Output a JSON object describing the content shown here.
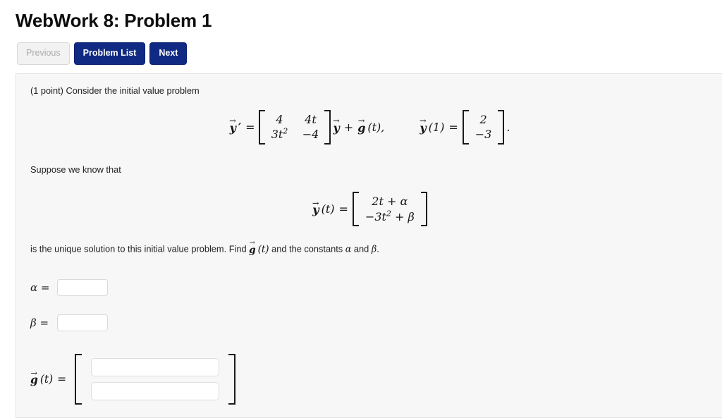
{
  "page": {
    "title": "WebWork 8: Problem 1"
  },
  "nav": {
    "previous_label": "Previous",
    "problem_list_label": "Problem List",
    "next_label": "Next",
    "primary_color": "#102a83",
    "disabled_color": "#f2f2f2"
  },
  "problem": {
    "intro": "(1 point) Consider the initial value problem",
    "suppose": "Suppose we know that",
    "question_prefix": "is the unique solution to this initial value problem. Find ",
    "question_middle": " and the constants ",
    "question_join": " and ",
    "question_suffix": ".",
    "equation1": {
      "lhs_symbol": "y",
      "lhs_prime": "′",
      "equals": "=",
      "matrix": {
        "row1": [
          "4",
          "4t"
        ],
        "row2": [
          "3t",
          "−4"
        ],
        "row2_exponent": "2"
      },
      "after_matrix_vector": "y",
      "plus": "+",
      "forcing_symbol": "g",
      "forcing_arg": "(t),",
      "initial_condition_symbol": "y",
      "initial_condition_arg": "(1)",
      "initial_condition_equals": "=",
      "initial_vector": [
        "2",
        "−3"
      ],
      "trailing_period": "."
    },
    "equation2": {
      "lhs_symbol": "y",
      "lhs_arg": "(t)",
      "equals": "=",
      "row1": "2t + α",
      "row2_prefix": "−3t",
      "row2_exponent": "2",
      "row2_suffix": " + β"
    },
    "inline_g": {
      "symbol": "g",
      "arg": "(t)"
    },
    "alpha_symbol": "α",
    "beta_symbol": "β"
  },
  "answers": {
    "alpha_label_symbol": "α",
    "beta_label_symbol": "β",
    "equals_sign": "=",
    "alpha_value": "",
    "beta_value": "",
    "g_label_symbol": "g",
    "g_label_arg": "(t)",
    "g_row1_value": "",
    "g_row2_value": "",
    "vector_arrow": "⃗"
  }
}
